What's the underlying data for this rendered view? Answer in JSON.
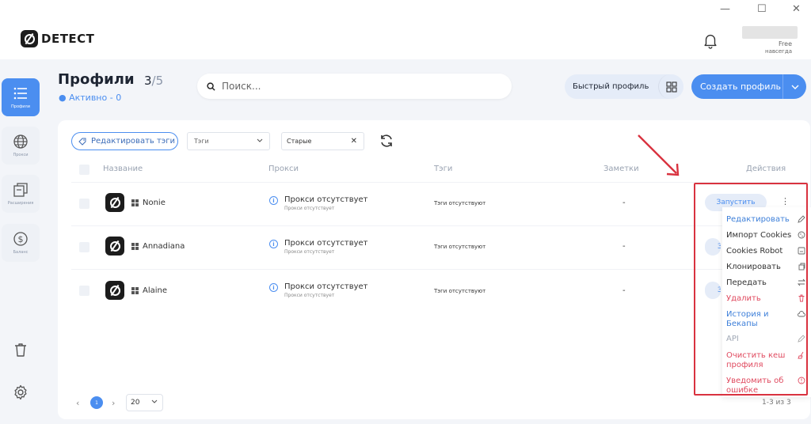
{
  "window": {
    "minimize": "—",
    "maximize": "☐",
    "close": "✕"
  },
  "app": {
    "logo_text": "DETECT"
  },
  "account": {
    "plan": "Free",
    "term": "навсегда"
  },
  "sidebar": {
    "items": [
      {
        "label": "Профили",
        "icon": "list-icon",
        "active": true
      },
      {
        "label": "Прокси",
        "icon": "globe-icon",
        "active": false
      },
      {
        "label": "Расширения",
        "icon": "extensions-icon",
        "active": false
      },
      {
        "label": "Баланс",
        "icon": "dollar-icon",
        "active": false
      }
    ]
  },
  "page": {
    "title": "Профили",
    "count": "3",
    "max": "/5",
    "active_status": "● Активно - 0"
  },
  "search": {
    "placeholder": "Поиск..."
  },
  "toolbar": {
    "quick_profile": "Быстрый профиль",
    "create_profile": "Создать профиль"
  },
  "filters": {
    "edit_tags": "Редактировать тэги",
    "tags_placeholder": "Тэги",
    "sort_value": "Старые"
  },
  "table": {
    "headers": {
      "name": "Название",
      "proxy": "Прокси",
      "tags": "Тэги",
      "notes": "Заметки",
      "actions": "Действия"
    },
    "rows": [
      {
        "name": "Nonie",
        "proxy": "Прокси отсутствует",
        "proxy_sub": "Прокси отсутствует",
        "tags": "Тэги отсутствуют",
        "notes": "-",
        "launch": "Запустить"
      },
      {
        "name": "Annadiana",
        "proxy": "Прокси отсутствует",
        "proxy_sub": "Прокси отсутствует",
        "tags": "Тэги отсутствуют",
        "notes": "-",
        "launch": "З"
      },
      {
        "name": "Alaine",
        "proxy": "Прокси отсутствует",
        "proxy_sub": "Прокси отсутствует",
        "tags": "Тэги отсутствуют",
        "notes": "-",
        "launch": "З"
      }
    ]
  },
  "menu": {
    "edit": "Редактировать",
    "import_cookies": "Импорт Cookies",
    "cookies_robot": "Cookies Robot",
    "clone": "Клонировать",
    "transfer": "Передать",
    "delete": "Удалить",
    "history_line1": "История и",
    "history_line2": "Бекапы",
    "api": "API",
    "clear_cache_line1": "Очистить кеш",
    "clear_cache_line2": "профиля",
    "report_line1": "Уведомить об",
    "report_line2": "ошибке"
  },
  "pagination": {
    "prev": "‹",
    "current": "1",
    "next": "›",
    "page_size": "20",
    "range": "1-3 из 3"
  },
  "colors": {
    "accent": "#4b8ef0",
    "danger": "#e04a5f",
    "highlight": "#d9323f"
  }
}
